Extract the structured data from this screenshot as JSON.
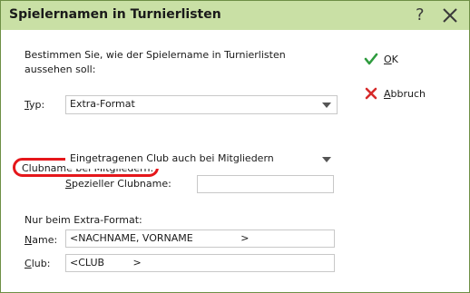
{
  "window": {
    "title": "Spielernamen in Turnierlisten",
    "help_glyph": "?"
  },
  "form": {
    "intro_line1": "Bestimmen Sie, wie der Spielername in Turnierlisten",
    "intro_line2": "aussehen soll:",
    "typ": {
      "label_accel": "T",
      "label_rest": "yp:",
      "value": "Extra-Format"
    },
    "clubname": {
      "label": "Clubname bei Mitgliedern:",
      "value": "Eingetragenen Club auch bei Mitgliedern"
    },
    "spezieller": {
      "label_accel": "S",
      "label_rest": "pezieller Clubname:",
      "value": ""
    },
    "extra_heading": "Nur beim Extra-Format:",
    "name": {
      "label_accel": "N",
      "label_rest": "ame:",
      "value": "<NACHNAME, VORNAME               >"
    },
    "club": {
      "label_accel": "C",
      "label_rest": "lub:",
      "value": "<CLUB         >"
    }
  },
  "buttons": {
    "ok": {
      "accel": "O",
      "rest": "K"
    },
    "cancel": {
      "accel": "A",
      "rest": "bbruch"
    }
  },
  "colors": {
    "titlebar": "#c9e0a5",
    "border": "#6e8f46",
    "highlight_ring": "#e5171b",
    "ok_icon": "#2e9b3e",
    "cancel_icon": "#d62a2a"
  },
  "icons": {
    "help": "question-mark-icon",
    "close": "close-icon",
    "ok": "checkmark-icon",
    "cancel": "cross-icon",
    "dropdown": "chevron-down-icon"
  }
}
